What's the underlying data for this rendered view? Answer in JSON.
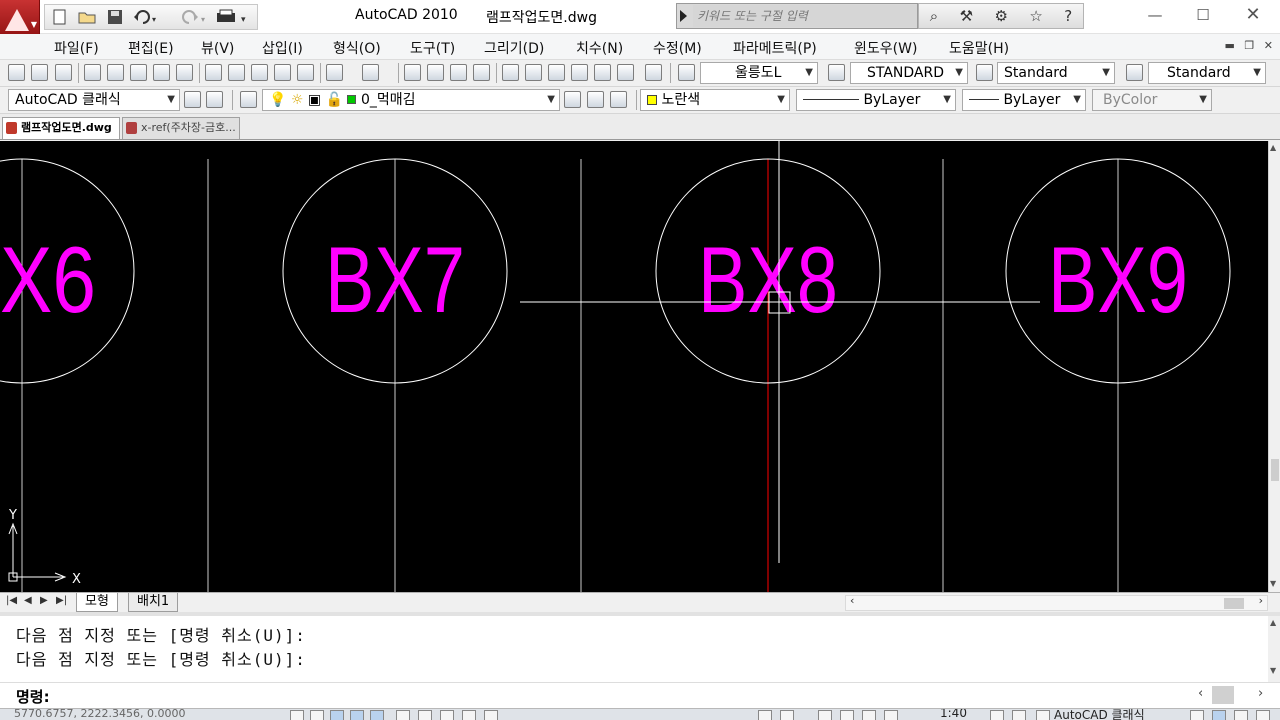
{
  "app": {
    "title": "AutoCAD 2010",
    "file": "램프작업도면.dwg"
  },
  "search": {
    "placeholder": "키워드 또는 구절 입력"
  },
  "menu": [
    "파일(F)",
    "편집(E)",
    "뷰(V)",
    "삽입(I)",
    "형식(O)",
    "도구(T)",
    "그리기(D)",
    "치수(N)",
    "수정(M)",
    "파라메트릭(P)",
    "윈도우(W)",
    "도움말(H)"
  ],
  "styles": {
    "text_style": "울릉도L",
    "dim_style": "STANDARD",
    "table_style": "Standard",
    "multileader_style": "Standard"
  },
  "workspace": "AutoCAD 클래식",
  "layer": {
    "current": "0_먹매김"
  },
  "properties": {
    "color": "노란색",
    "linetype": "ByLayer",
    "lineweight": "ByLayer",
    "plotstyle": "ByColor"
  },
  "doc_tabs": [
    {
      "label": "램프작업도면.dwg",
      "active": true
    },
    {
      "label": "x-ref(주차장-금호...",
      "active": false
    }
  ],
  "drawing": {
    "bubbles": [
      "X6",
      "BX7",
      "BX8",
      "BX9"
    ],
    "ucs_x": "X",
    "ucs_y": "Y",
    "text_color": "#ff00ff",
    "line_color": "#ffffff",
    "hidden_line_color": "#ff0000"
  },
  "layout_tabs": [
    {
      "label": "모형",
      "active": true
    },
    {
      "label": "배치1",
      "active": false
    }
  ],
  "command": {
    "history": [
      "다음 점 지정 또는 [명령 취소(U)]:",
      "다음 점 지정 또는 [명령 취소(U)]:"
    ],
    "prompt": "명령:",
    "value": ""
  },
  "status": {
    "coords": "5770.6757, 2222.3456, 0.0000",
    "scale": "1:40",
    "workspace": "AutoCAD 클래식"
  }
}
